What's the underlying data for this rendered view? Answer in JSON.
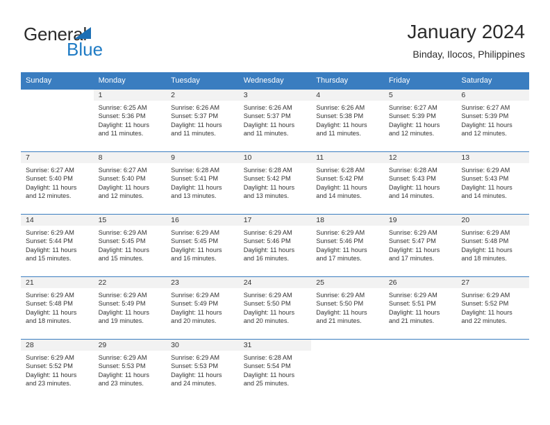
{
  "brand": {
    "name_part1": "General",
    "name_part2": "Blue",
    "accent_color": "#1f7bc4",
    "triangle_color": "#1c6fb5"
  },
  "header": {
    "title": "January 2024",
    "subtitle": "Binday, Ilocos, Philippines"
  },
  "calendar": {
    "header_bg": "#3a7dc0",
    "daynum_bg": "#f2f2f2",
    "weekdays": [
      "Sunday",
      "Monday",
      "Tuesday",
      "Wednesday",
      "Thursday",
      "Friday",
      "Saturday"
    ],
    "weeks": [
      [
        {
          "day": "",
          "sunrise": "",
          "sunset": "",
          "daylight_line1": "",
          "daylight_line2": ""
        },
        {
          "day": "1",
          "sunrise": "Sunrise: 6:25 AM",
          "sunset": "Sunset: 5:36 PM",
          "daylight_line1": "Daylight: 11 hours",
          "daylight_line2": "and 11 minutes."
        },
        {
          "day": "2",
          "sunrise": "Sunrise: 6:26 AM",
          "sunset": "Sunset: 5:37 PM",
          "daylight_line1": "Daylight: 11 hours",
          "daylight_line2": "and 11 minutes."
        },
        {
          "day": "3",
          "sunrise": "Sunrise: 6:26 AM",
          "sunset": "Sunset: 5:37 PM",
          "daylight_line1": "Daylight: 11 hours",
          "daylight_line2": "and 11 minutes."
        },
        {
          "day": "4",
          "sunrise": "Sunrise: 6:26 AM",
          "sunset": "Sunset: 5:38 PM",
          "daylight_line1": "Daylight: 11 hours",
          "daylight_line2": "and 11 minutes."
        },
        {
          "day": "5",
          "sunrise": "Sunrise: 6:27 AM",
          "sunset": "Sunset: 5:39 PM",
          "daylight_line1": "Daylight: 11 hours",
          "daylight_line2": "and 12 minutes."
        },
        {
          "day": "6",
          "sunrise": "Sunrise: 6:27 AM",
          "sunset": "Sunset: 5:39 PM",
          "daylight_line1": "Daylight: 11 hours",
          "daylight_line2": "and 12 minutes."
        }
      ],
      [
        {
          "day": "7",
          "sunrise": "Sunrise: 6:27 AM",
          "sunset": "Sunset: 5:40 PM",
          "daylight_line1": "Daylight: 11 hours",
          "daylight_line2": "and 12 minutes."
        },
        {
          "day": "8",
          "sunrise": "Sunrise: 6:27 AM",
          "sunset": "Sunset: 5:40 PM",
          "daylight_line1": "Daylight: 11 hours",
          "daylight_line2": "and 12 minutes."
        },
        {
          "day": "9",
          "sunrise": "Sunrise: 6:28 AM",
          "sunset": "Sunset: 5:41 PM",
          "daylight_line1": "Daylight: 11 hours",
          "daylight_line2": "and 13 minutes."
        },
        {
          "day": "10",
          "sunrise": "Sunrise: 6:28 AM",
          "sunset": "Sunset: 5:42 PM",
          "daylight_line1": "Daylight: 11 hours",
          "daylight_line2": "and 13 minutes."
        },
        {
          "day": "11",
          "sunrise": "Sunrise: 6:28 AM",
          "sunset": "Sunset: 5:42 PM",
          "daylight_line1": "Daylight: 11 hours",
          "daylight_line2": "and 14 minutes."
        },
        {
          "day": "12",
          "sunrise": "Sunrise: 6:28 AM",
          "sunset": "Sunset: 5:43 PM",
          "daylight_line1": "Daylight: 11 hours",
          "daylight_line2": "and 14 minutes."
        },
        {
          "day": "13",
          "sunrise": "Sunrise: 6:29 AM",
          "sunset": "Sunset: 5:43 PM",
          "daylight_line1": "Daylight: 11 hours",
          "daylight_line2": "and 14 minutes."
        }
      ],
      [
        {
          "day": "14",
          "sunrise": "Sunrise: 6:29 AM",
          "sunset": "Sunset: 5:44 PM",
          "daylight_line1": "Daylight: 11 hours",
          "daylight_line2": "and 15 minutes."
        },
        {
          "day": "15",
          "sunrise": "Sunrise: 6:29 AM",
          "sunset": "Sunset: 5:45 PM",
          "daylight_line1": "Daylight: 11 hours",
          "daylight_line2": "and 15 minutes."
        },
        {
          "day": "16",
          "sunrise": "Sunrise: 6:29 AM",
          "sunset": "Sunset: 5:45 PM",
          "daylight_line1": "Daylight: 11 hours",
          "daylight_line2": "and 16 minutes."
        },
        {
          "day": "17",
          "sunrise": "Sunrise: 6:29 AM",
          "sunset": "Sunset: 5:46 PM",
          "daylight_line1": "Daylight: 11 hours",
          "daylight_line2": "and 16 minutes."
        },
        {
          "day": "18",
          "sunrise": "Sunrise: 6:29 AM",
          "sunset": "Sunset: 5:46 PM",
          "daylight_line1": "Daylight: 11 hours",
          "daylight_line2": "and 17 minutes."
        },
        {
          "day": "19",
          "sunrise": "Sunrise: 6:29 AM",
          "sunset": "Sunset: 5:47 PM",
          "daylight_line1": "Daylight: 11 hours",
          "daylight_line2": "and 17 minutes."
        },
        {
          "day": "20",
          "sunrise": "Sunrise: 6:29 AM",
          "sunset": "Sunset: 5:48 PM",
          "daylight_line1": "Daylight: 11 hours",
          "daylight_line2": "and 18 minutes."
        }
      ],
      [
        {
          "day": "21",
          "sunrise": "Sunrise: 6:29 AM",
          "sunset": "Sunset: 5:48 PM",
          "daylight_line1": "Daylight: 11 hours",
          "daylight_line2": "and 18 minutes."
        },
        {
          "day": "22",
          "sunrise": "Sunrise: 6:29 AM",
          "sunset": "Sunset: 5:49 PM",
          "daylight_line1": "Daylight: 11 hours",
          "daylight_line2": "and 19 minutes."
        },
        {
          "day": "23",
          "sunrise": "Sunrise: 6:29 AM",
          "sunset": "Sunset: 5:49 PM",
          "daylight_line1": "Daylight: 11 hours",
          "daylight_line2": "and 20 minutes."
        },
        {
          "day": "24",
          "sunrise": "Sunrise: 6:29 AM",
          "sunset": "Sunset: 5:50 PM",
          "daylight_line1": "Daylight: 11 hours",
          "daylight_line2": "and 20 minutes."
        },
        {
          "day": "25",
          "sunrise": "Sunrise: 6:29 AM",
          "sunset": "Sunset: 5:50 PM",
          "daylight_line1": "Daylight: 11 hours",
          "daylight_line2": "and 21 minutes."
        },
        {
          "day": "26",
          "sunrise": "Sunrise: 6:29 AM",
          "sunset": "Sunset: 5:51 PM",
          "daylight_line1": "Daylight: 11 hours",
          "daylight_line2": "and 21 minutes."
        },
        {
          "day": "27",
          "sunrise": "Sunrise: 6:29 AM",
          "sunset": "Sunset: 5:52 PM",
          "daylight_line1": "Daylight: 11 hours",
          "daylight_line2": "and 22 minutes."
        }
      ],
      [
        {
          "day": "28",
          "sunrise": "Sunrise: 6:29 AM",
          "sunset": "Sunset: 5:52 PM",
          "daylight_line1": "Daylight: 11 hours",
          "daylight_line2": "and 23 minutes."
        },
        {
          "day": "29",
          "sunrise": "Sunrise: 6:29 AM",
          "sunset": "Sunset: 5:53 PM",
          "daylight_line1": "Daylight: 11 hours",
          "daylight_line2": "and 23 minutes."
        },
        {
          "day": "30",
          "sunrise": "Sunrise: 6:29 AM",
          "sunset": "Sunset: 5:53 PM",
          "daylight_line1": "Daylight: 11 hours",
          "daylight_line2": "and 24 minutes."
        },
        {
          "day": "31",
          "sunrise": "Sunrise: 6:28 AM",
          "sunset": "Sunset: 5:54 PM",
          "daylight_line1": "Daylight: 11 hours",
          "daylight_line2": "and 25 minutes."
        },
        {
          "day": "",
          "sunrise": "",
          "sunset": "",
          "daylight_line1": "",
          "daylight_line2": ""
        },
        {
          "day": "",
          "sunrise": "",
          "sunset": "",
          "daylight_line1": "",
          "daylight_line2": ""
        },
        {
          "day": "",
          "sunrise": "",
          "sunset": "",
          "daylight_line1": "",
          "daylight_line2": ""
        }
      ]
    ]
  }
}
